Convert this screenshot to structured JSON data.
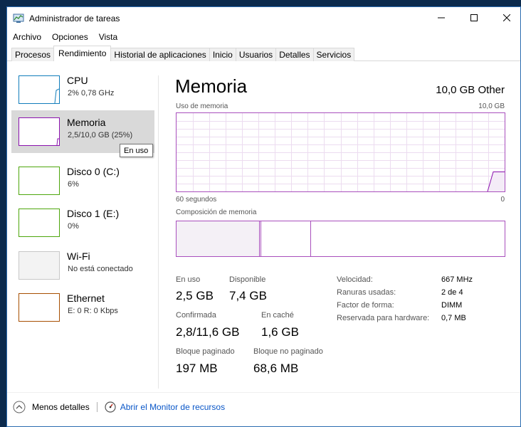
{
  "window": {
    "title": "Administrador de tareas"
  },
  "menu": [
    "Archivo",
    "Opciones",
    "Vista"
  ],
  "tabs": [
    "Procesos",
    "Rendimiento",
    "Historial de aplicaciones",
    "Inicio",
    "Usuarios",
    "Detalles",
    "Servicios"
  ],
  "active_tab": "Rendimiento",
  "sidebar": {
    "items": [
      {
        "name": "CPU",
        "sub": "2% 0,78 GHz",
        "color": "#117dbb"
      },
      {
        "name": "Memoria",
        "sub": "2,5/10,0 GB (25%)",
        "color": "#8b12ae"
      },
      {
        "name": "Disco 0 (C:)",
        "sub": "6%",
        "color": "#4da60c"
      },
      {
        "name": "Disco 1 (E:)",
        "sub": "0%",
        "color": "#4da60c"
      },
      {
        "name": "Wi-Fi",
        "sub": "No está conectado",
        "color": "#c8c8c8"
      },
      {
        "name": "Ethernet",
        "sub": "E: 0 R: 0 Kbps",
        "color": "#a74f01"
      }
    ],
    "tooltip": "En uso"
  },
  "main": {
    "title": "Memoria",
    "total": "10,0 GB Other",
    "graph_label": "Uso de memoria",
    "graph_max": "10,0 GB",
    "graph_time": "60 segundos",
    "graph_min": "0",
    "composition_label": "Composición de memoria",
    "accent": "#8b12ae",
    "usage_percent": 25
  },
  "stats": {
    "in_use": {
      "label": "En uso",
      "value": "2,5 GB"
    },
    "available": {
      "label": "Disponible",
      "value": "7,4 GB"
    },
    "committed": {
      "label": "Confirmada",
      "value": "2,8/11,6 GB"
    },
    "cached": {
      "label": "En caché",
      "value": "1,6 GB"
    },
    "paged": {
      "label": "Bloque paginado",
      "value": "197 MB"
    },
    "nonpaged": {
      "label": "Bloque no paginado",
      "value": "68,6 MB"
    }
  },
  "props": [
    {
      "label": "Velocidad:",
      "value": "667 MHz"
    },
    {
      "label": "Ranuras usadas:",
      "value": "2 de 4"
    },
    {
      "label": "Factor de forma:",
      "value": "DIMM"
    },
    {
      "label": "Reservada para hardware:",
      "value": "0,7 MB"
    }
  ],
  "footer": {
    "less_details": "Menos detalles",
    "open_monitor": "Abrir el Monitor de recursos"
  }
}
